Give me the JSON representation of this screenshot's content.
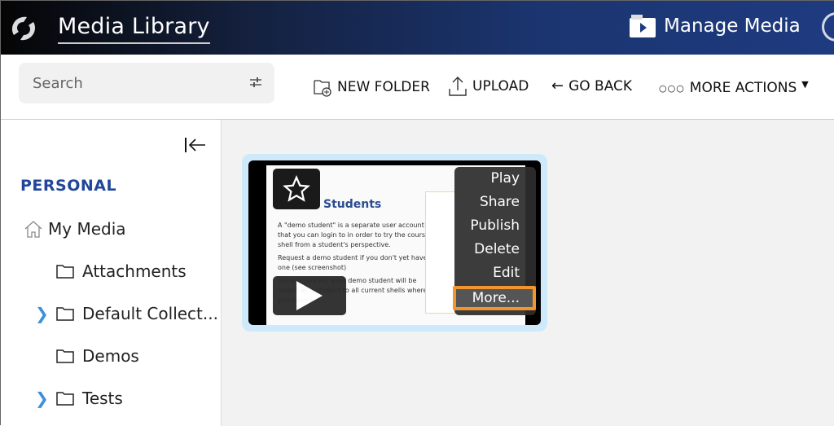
{
  "header": {
    "title": "Media Library",
    "manage_media": "Manage Media"
  },
  "toolbar": {
    "search_placeholder": "Search",
    "new_folder": "NEW FOLDER",
    "upload": "UPLOAD",
    "go_back": "GO BACK",
    "more_actions": "MORE ACTIONS"
  },
  "sidebar": {
    "section": "PERSONAL",
    "my_media": "My Media",
    "folders": [
      {
        "label": "Attachments",
        "expandable": false
      },
      {
        "label": "Default Collect...",
        "expandable": true
      },
      {
        "label": "Demos",
        "expandable": false
      },
      {
        "label": "Tests",
        "expandable": true
      }
    ]
  },
  "media_card": {
    "thumbnail": {
      "heading": "Students",
      "body": "A \"demo student\" is a separate user account that you can login to in order to try the course shell from a student's perspective.",
      "bullet1": "Request a demo student if you don't yet have one (see screenshot)",
      "bullet2": "Once activated, your demo student will be added as a student to all current shells where you have an"
    },
    "menu": [
      "Play",
      "Share",
      "Publish",
      "Delete",
      "Edit"
    ],
    "more": "More..."
  },
  "colors": {
    "accent": "#21469a",
    "highlight": "#f0962c",
    "card_border": "#cde9fa",
    "chevron": "#3d8fdc"
  }
}
